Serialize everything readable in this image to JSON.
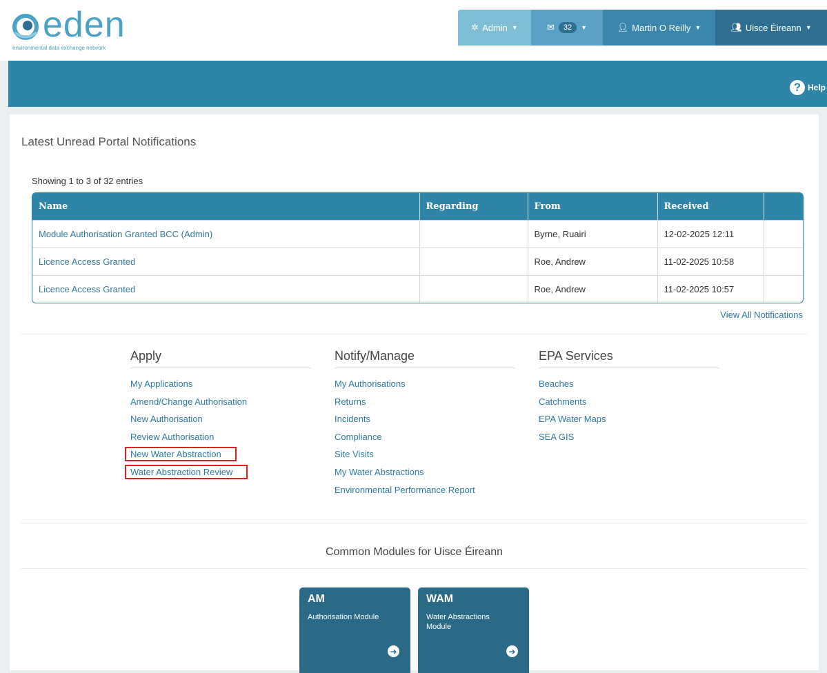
{
  "header": {
    "logo_word": "eden",
    "logo_tagline": "environmental data exchange network",
    "admin_label": "Admin",
    "messages_count": "32",
    "user_label": "Martin O Reilly",
    "org_label": "Uisce Éireann",
    "help_label": "Help"
  },
  "notifications": {
    "title": "Latest Unread Portal Notifications",
    "showing": "Showing 1 to 3 of 32 entries",
    "columns": [
      "Name",
      "Regarding",
      "From",
      "Received"
    ],
    "rows": [
      {
        "name": "Module Authorisation Granted BCC (Admin)",
        "regarding": "",
        "from": "Byrne, Ruairi",
        "received": "12-02-2025 12:11"
      },
      {
        "name": "Licence Access Granted",
        "regarding": "",
        "from": "Roe, Andrew",
        "received": "11-02-2025 10:58"
      },
      {
        "name": "Licence Access Granted",
        "regarding": "",
        "from": "Roe, Andrew",
        "received": "11-02-2025 10:57"
      }
    ],
    "view_all": "View All Notifications"
  },
  "menus": {
    "apply": {
      "title": "Apply",
      "items": [
        "My Applications",
        "Amend/Change Authorisation",
        "New Authorisation",
        "Review Authorisation",
        "New Water Abstraction",
        "Water Abstraction Review"
      ]
    },
    "notify": {
      "title": "Notify/Manage",
      "items": [
        "My Authorisations",
        "Returns",
        "Incidents",
        "Compliance",
        "Site Visits",
        "My Water Abstractions",
        "Environmental Performance Report"
      ]
    },
    "epa": {
      "title": "EPA Services",
      "items": [
        "Beaches",
        "Catchments",
        "EPA Water Maps",
        "SEA GIS"
      ]
    }
  },
  "modules": {
    "title": "Common Modules for Uisce Éireann",
    "tiles": [
      {
        "code": "AM",
        "name": "Authorisation Module"
      },
      {
        "code": "WAM",
        "name": "Water Abstractions Module"
      }
    ]
  },
  "colors": {
    "brand_blue": "#2f85a7",
    "tile_blue": "#2a6a86",
    "link": "#2f7aa3",
    "highlight_box": "#e02020"
  }
}
